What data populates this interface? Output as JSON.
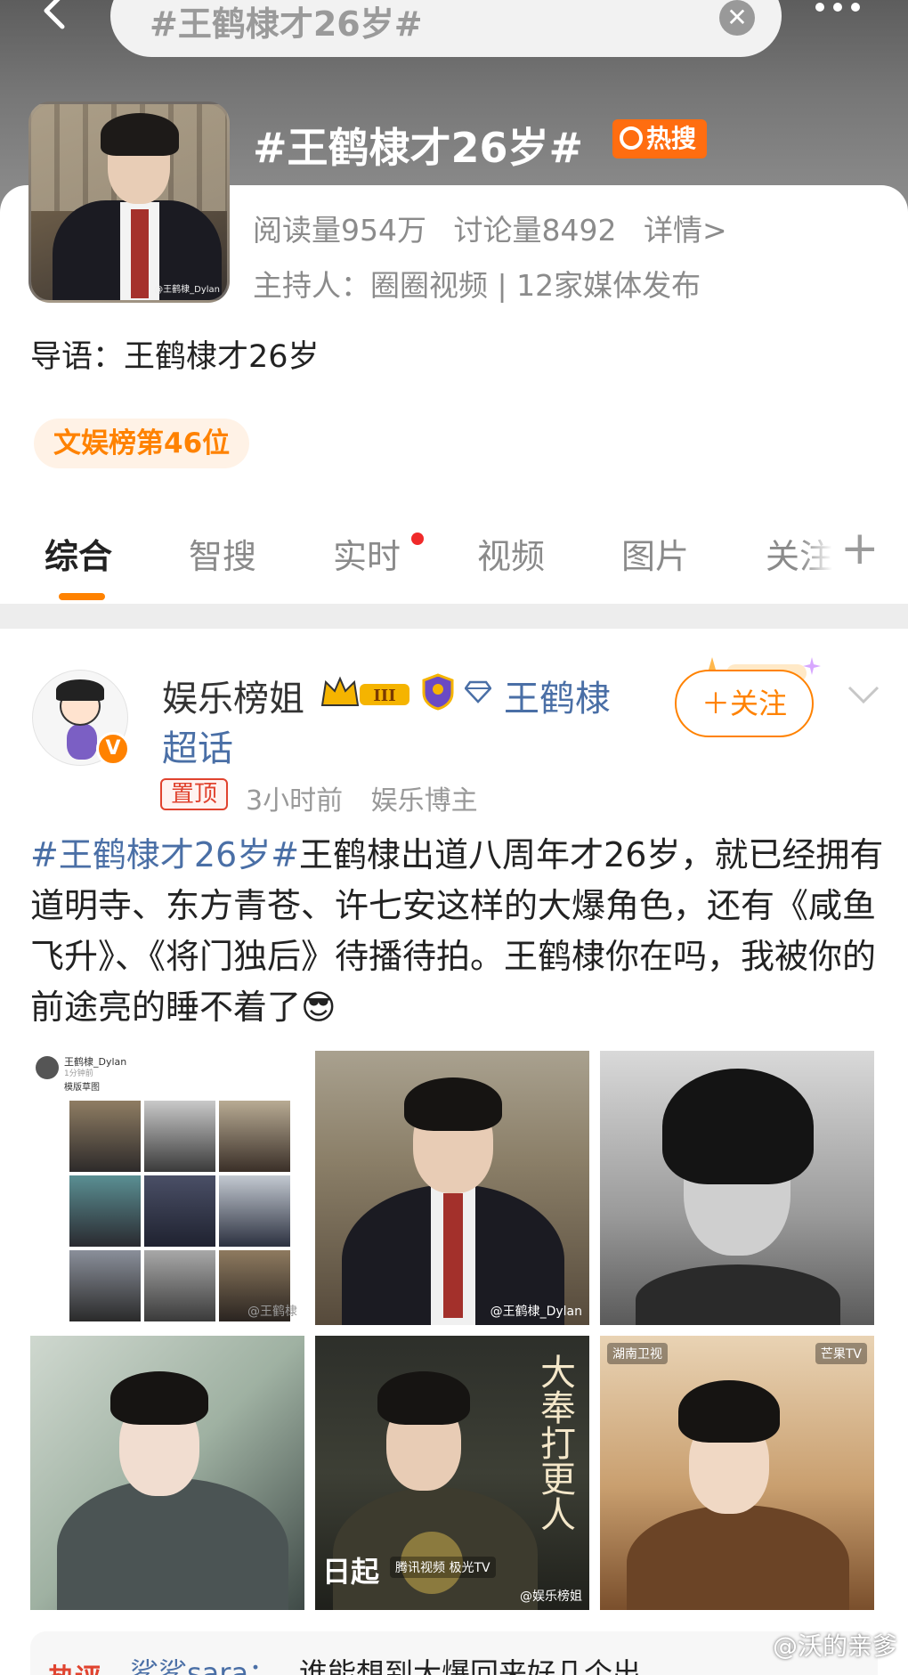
{
  "search": {
    "query": "#王鹤棣才26岁#",
    "clear_symbol": "✕"
  },
  "topic": {
    "title": "#王鹤棣才26岁#",
    "hot_badge": "热搜",
    "cover_watermark": "@王鹤棣_Dylan",
    "reads": "阅读量954万",
    "discussions": "讨论量8492",
    "detail_link": "详情>",
    "host": "主持人：圈圈视频 | 12家媒体发布",
    "guide": "导语：王鹤棣才26岁",
    "rank": "文娱榜第46位"
  },
  "tabs": [
    {
      "label": "综合",
      "active": true
    },
    {
      "label": "智搜",
      "active": false
    },
    {
      "label": "实时",
      "active": false,
      "dot": true
    },
    {
      "label": "视频",
      "active": false
    },
    {
      "label": "图片",
      "active": false
    },
    {
      "label": "关注",
      "active": false
    }
  ],
  "tabs_plus": "+",
  "post": {
    "username": "娱乐榜姐",
    "level_badge": "III",
    "supertopic_1": "王鹤棣",
    "supertopic_2": "超话",
    "follow_label": "＋关注",
    "pin_label": "置顶",
    "time": "3小时前",
    "role": "娱乐博主",
    "hashtag": "#王鹤棣才26岁#",
    "body": "王鹤棣出道八周年才26岁，就已经拥有道明寺、东方青苍、许七安这样的大爆角色，还有《咸鱼飞升》、《将门独后》待播待拍。王鹤棣你在吗，我被你的前途亮的睡不着了",
    "emoji": "😎",
    "images": [
      {
        "id": "img1",
        "kind": "collage",
        "mini_name": "王鹤棣_Dylan",
        "mini_time": "1分钟前",
        "mini_caption": "模版草图",
        "watermark": "@王鹤棣"
      },
      {
        "id": "img2",
        "kind": "photo",
        "watermark": "@王鹤棣_Dylan"
      },
      {
        "id": "img3",
        "kind": "photo",
        "watermark": ""
      },
      {
        "id": "img4",
        "kind": "photo",
        "watermark": ""
      },
      {
        "id": "img5",
        "kind": "poster",
        "title": "大奉打更人",
        "date": "日起",
        "logo": "腾讯视频 极光TV",
        "watermark": "@娱乐榜姐"
      },
      {
        "id": "img6",
        "kind": "poster",
        "logo_left": "湖南卫视",
        "logo_right": "芒果TV",
        "watermark": ""
      }
    ]
  },
  "comment_peek": {
    "label": "热评",
    "user": "鲨鲨sara：",
    "text": "谁能想到大爆回来好几个出"
  },
  "corner_watermark": "@沃的亲爹",
  "colors": {
    "accent": "#ff8200",
    "link": "#4a6fa6",
    "hot": "#ff6d10",
    "pin": "#e0432f"
  }
}
